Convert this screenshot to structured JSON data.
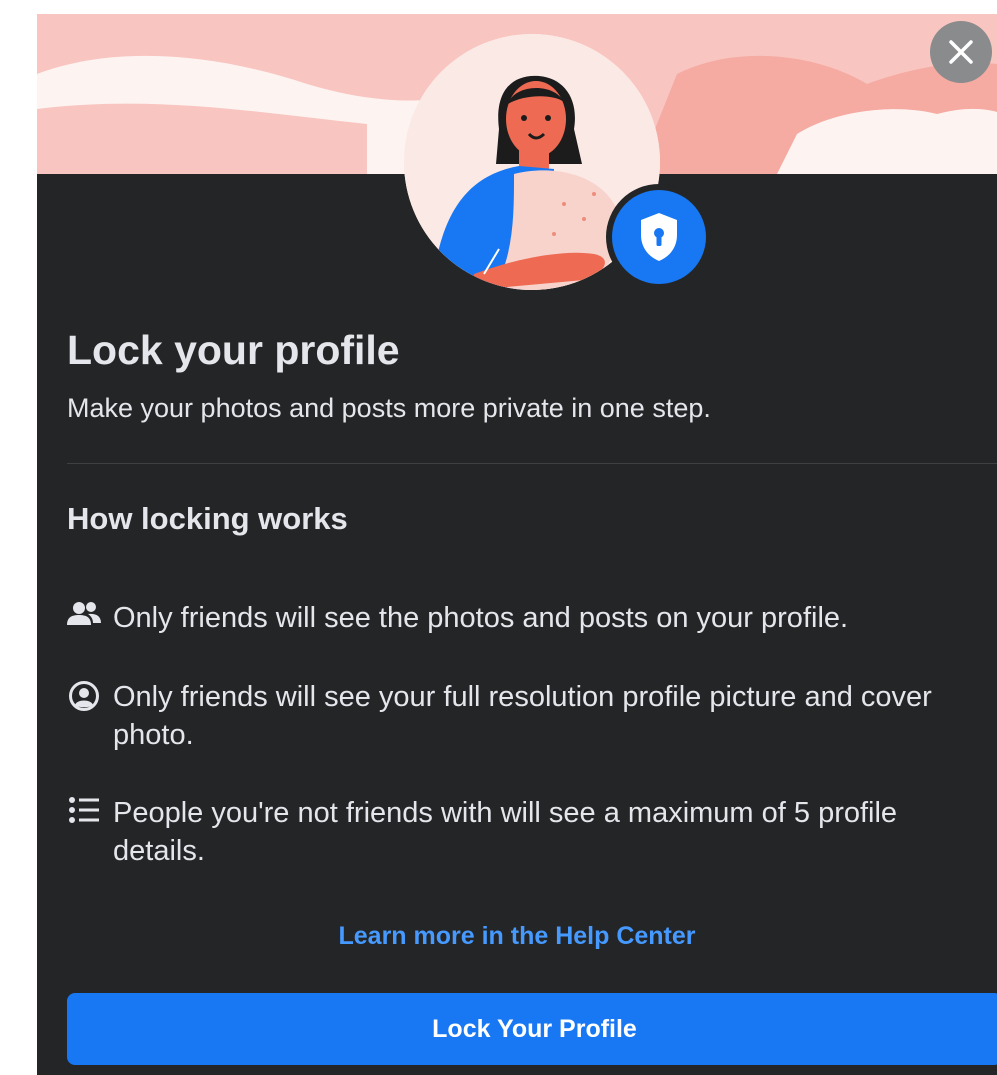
{
  "dialog": {
    "close_icon": "close-icon",
    "title": "Lock your profile",
    "subtitle": "Make your photos and posts more private in one step.",
    "section_title": "How locking works",
    "items": [
      {
        "icon": "friends-icon",
        "text": "Only friends will see the photos and posts on your profile."
      },
      {
        "icon": "profile-circle-icon",
        "text": "Only friends will see your full resolution profile picture and cover photo."
      },
      {
        "icon": "list-icon",
        "text": "People you're not friends with will see a maximum of 5 profile details."
      }
    ],
    "help_link": "Learn more in the Help Center",
    "button_label": "Lock Your Profile"
  },
  "colors": {
    "background": "#242526",
    "header_pink": "#f9c5c0",
    "accent_blue": "#1877f2",
    "link_blue": "#4599ff",
    "text_primary": "#e4e6eb"
  }
}
